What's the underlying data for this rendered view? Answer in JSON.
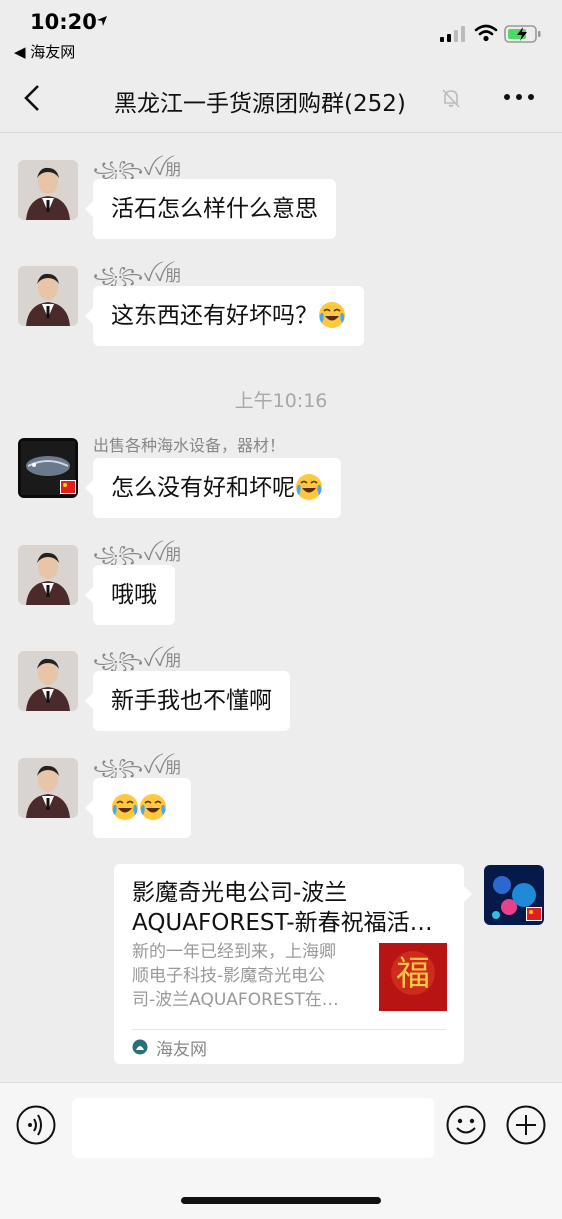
{
  "status_bar": {
    "time": "10:20",
    "back_app": "◀ 海友网"
  },
  "nav": {
    "title": "黑龙江一手货源团购群(252)"
  },
  "messages": [
    {
      "sender": "꧁꧂ꪜꪜ朋",
      "text": "活石怎么样什么意思"
    },
    {
      "sender": "꧁꧂ꪜꪜ朋",
      "text": "这东西还有好坏吗？",
      "emoji": "crying-laughing"
    },
    {
      "sender": "出售各种海水设备，器材！",
      "text": "怎么没有好和坏呢",
      "emoji": "crying-laughing"
    },
    {
      "sender": "꧁꧂ꪜꪜ朋",
      "text": "哦哦"
    },
    {
      "sender": "꧁꧂ꪜꪜ朋",
      "text": "新手我也不懂啊"
    },
    {
      "sender": "꧁꧂ꪜꪜ朋",
      "emojis": [
        "crying-laughing",
        "crying-laughing"
      ]
    }
  ],
  "timestamp": "上午10:16",
  "shared_card": {
    "title_line1": "影魔奇光电公司-波兰",
    "title_line2": "AQUAFOREST-新春祝福活…",
    "desc_line1": "新的一年已经到来，上海卿",
    "desc_line2": "顺电子科技-影魔奇光电公",
    "desc_line3": "司-波兰AQUAFOREST在…",
    "thumb_text": "福",
    "source": "海友网"
  },
  "input": {
    "placeholder": ""
  },
  "colors": {
    "bg": "#ededed",
    "bubble": "#ffffff",
    "thumb": "#c01818"
  }
}
